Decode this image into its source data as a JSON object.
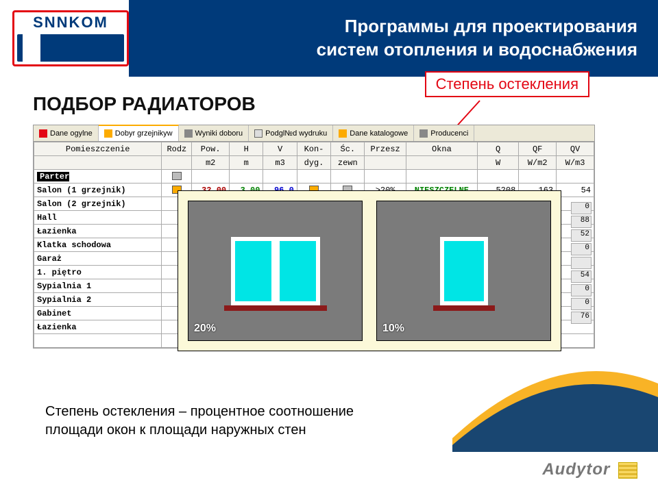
{
  "banner": {
    "logo_text": "SNNKOM",
    "title_l1": "Программы для проектирования",
    "title_l2": "систем отопления и водоснабжения"
  },
  "slide": {
    "title": "ПОДБОР РАДИАТОРОВ",
    "callout": "Степень остекления",
    "caption_l1": "Степень остекления – процентное соотношение",
    "caption_l2": "площади окон к площади наружных стен"
  },
  "tabs": [
    {
      "label": "Dane ogуlne",
      "icon": "icon-home"
    },
    {
      "label": "Dobуr grzejnikуw",
      "icon": "icon-yellow",
      "active": true
    },
    {
      "label": "Wyniki doboru",
      "icon": "icon-gray"
    },
    {
      "label": "Podgl№d wydruku",
      "icon": "icon-doc"
    },
    {
      "label": "Dane katalogowe",
      "icon": "icon-yellow"
    },
    {
      "label": "Producenci",
      "icon": "icon-gray"
    }
  ],
  "columns": {
    "head": [
      "Pomieszczenie",
      "Rodz",
      "Pow.",
      "H",
      "V",
      "Kon-",
      "Śc.",
      "Przesz",
      "Okna",
      "Q",
      "QF",
      "QV"
    ],
    "units": [
      "",
      "",
      "m2",
      "m",
      "m3",
      "dyg.",
      "zewn",
      "",
      "",
      "W",
      "W/m2",
      "W/m3"
    ]
  },
  "rows": {
    "parter": "Parter",
    "salon1": {
      "name": "Salon (1 grzejnik)",
      "pow": "32,00",
      "h": "3,00",
      "v": "96,0",
      "przesz": ">20%",
      "okna": "NIESZCZELNE",
      "q": "5208",
      "qf": "163",
      "qv": "54"
    },
    "others": [
      "Salon (2 grzejnik)",
      "Hall",
      "Łazienka",
      "Klatka schodowa",
      "Garaż",
      "1. piętro",
      "Sypialnia 1",
      "Sypialnia 2",
      "Gabinet",
      "Łazienka"
    ],
    "sidevals": [
      "0",
      "88",
      "52",
      "0",
      "",
      "54",
      "0",
      "0",
      "76"
    ]
  },
  "popup": {
    "pct_left": "20%",
    "pct_right": "10%"
  },
  "watermark": "Audytor"
}
